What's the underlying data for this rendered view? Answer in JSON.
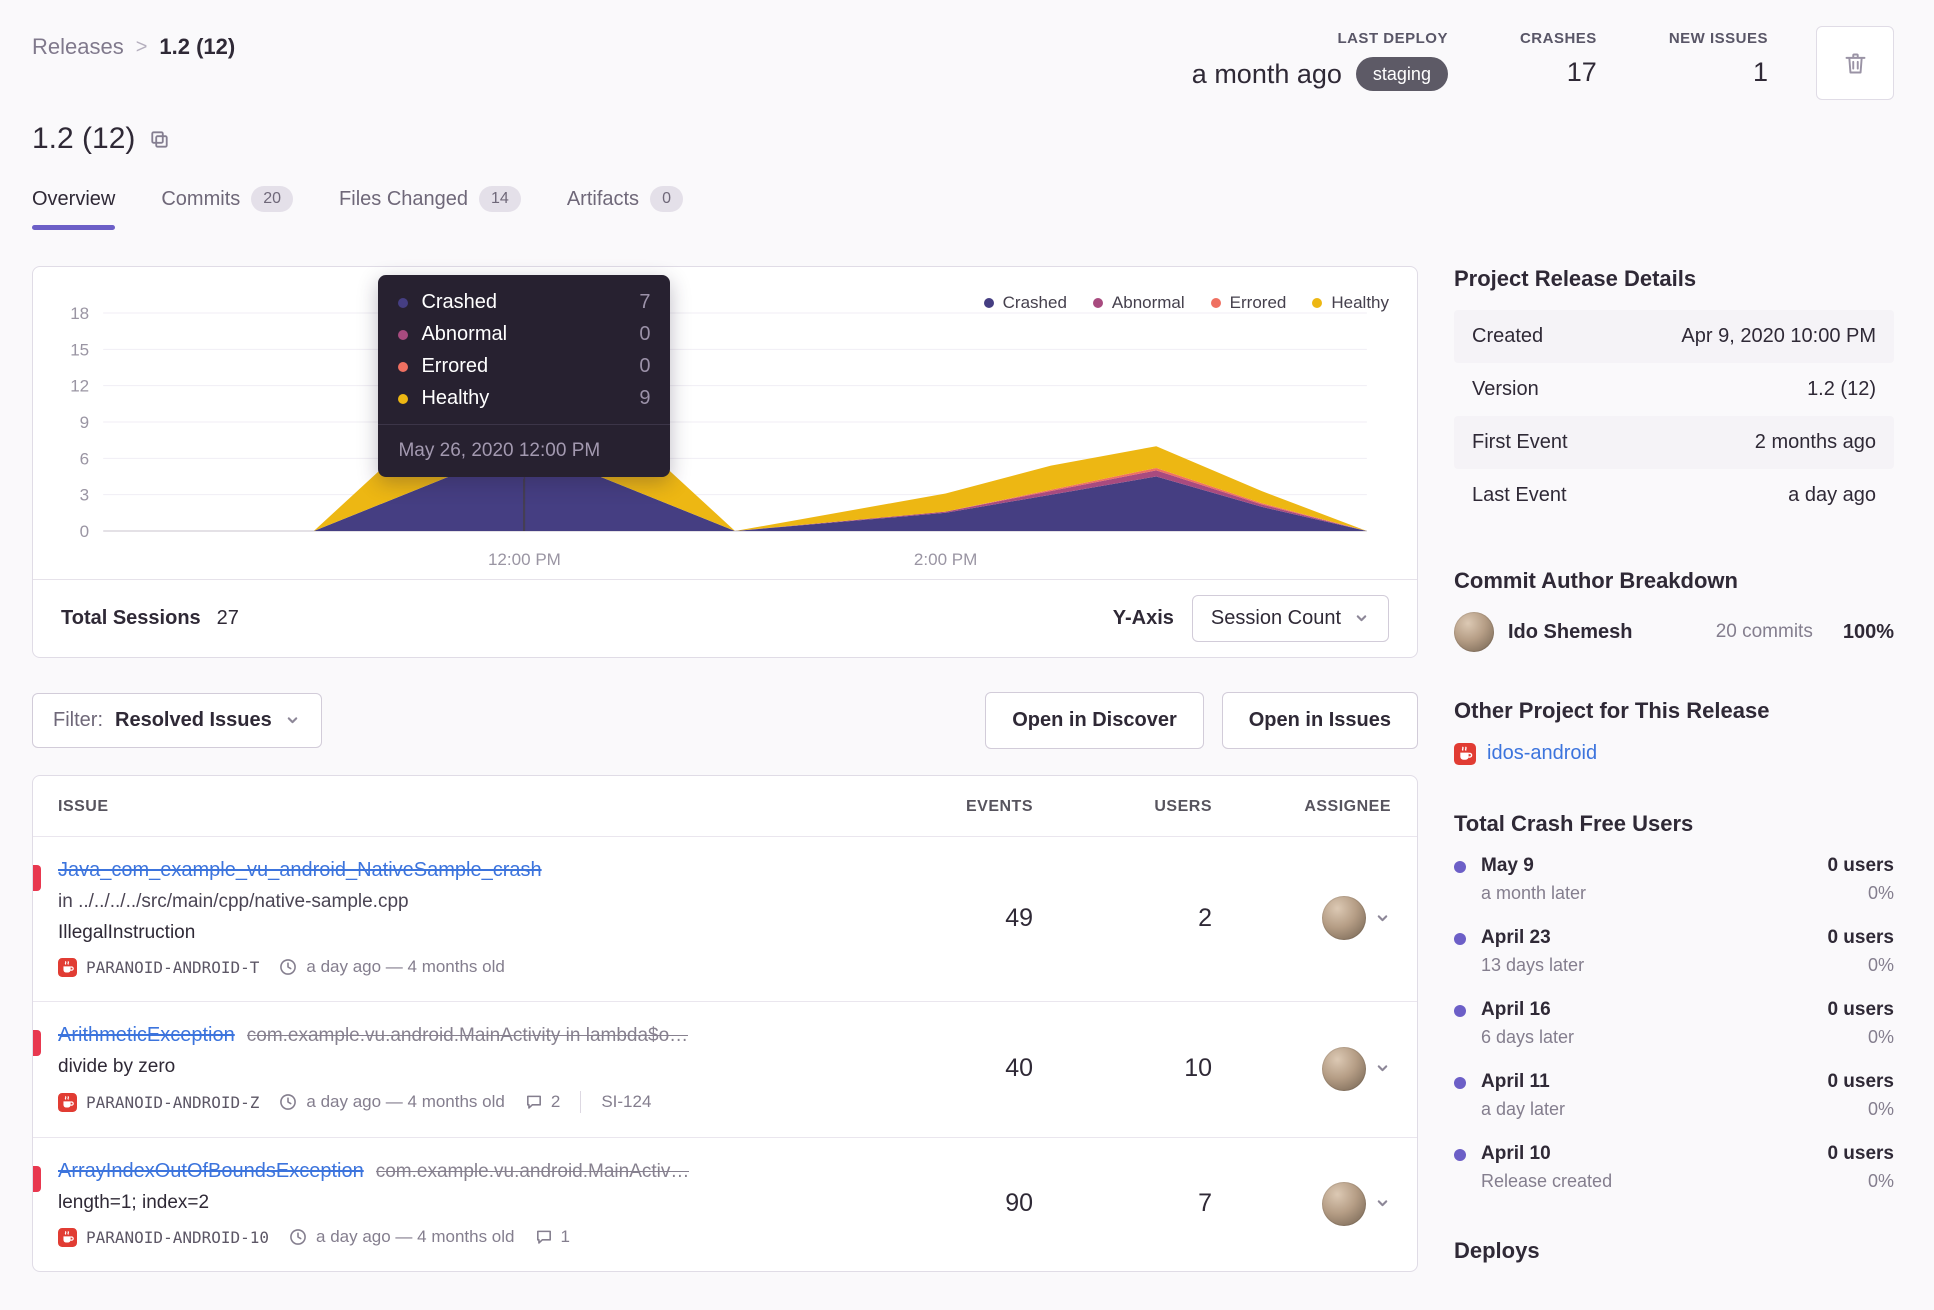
{
  "breadcrumb": {
    "parent": "Releases",
    "separator": ">",
    "current": "1.2 (12)"
  },
  "header_stats": {
    "last_deploy": {
      "label": "LAST DEPLOY",
      "value": "a month ago",
      "badge": "staging"
    },
    "crashes": {
      "label": "CRASHES",
      "value": "17"
    },
    "new_issues": {
      "label": "NEW ISSUES",
      "value": "1"
    }
  },
  "page_title": "1.2 (12)",
  "tabs": [
    {
      "label": "Overview",
      "active": true
    },
    {
      "label": "Commits",
      "count": "20"
    },
    {
      "label": "Files Changed",
      "count": "14"
    },
    {
      "label": "Artifacts",
      "count": "0"
    }
  ],
  "chart": {
    "tooltip": {
      "rows": [
        {
          "label": "Crashed",
          "value": "7"
        },
        {
          "label": "Abnormal",
          "value": "0"
        },
        {
          "label": "Errored",
          "value": "0"
        },
        {
          "label": "Healthy",
          "value": "9"
        }
      ],
      "date": "May 26, 2020 12:00 PM"
    },
    "footer": {
      "total_label": "Total Sessions",
      "total_value": "27",
      "yaxis_label": "Y-Axis",
      "yaxis_value": "Session Count"
    }
  },
  "chart_data": {
    "type": "area",
    "stacked": true,
    "x_range": [
      0,
      6
    ],
    "x": [
      0,
      1,
      2,
      3,
      4,
      4.5,
      5,
      5.5,
      6
    ],
    "series": [
      {
        "name": "Crashed",
        "color": "#453e82",
        "values": [
          0,
          0,
          7,
          0,
          1.5,
          3,
          4.5,
          2,
          0
        ]
      },
      {
        "name": "Abnormal",
        "color": "#a84b7f",
        "values": [
          0,
          0,
          0,
          0,
          0.1,
          0.3,
          0.5,
          0.2,
          0
        ]
      },
      {
        "name": "Errored",
        "color": "#ef7061",
        "values": [
          0,
          0,
          0,
          0,
          0,
          0.1,
          0.2,
          0.1,
          0
        ]
      },
      {
        "name": "Healthy",
        "color": "#edb713",
        "values": [
          0,
          0,
          9,
          0,
          1.5,
          2,
          1.8,
          1,
          0
        ]
      }
    ],
    "ylim": [
      0,
      18
    ],
    "yticks": [
      0,
      3,
      6,
      9,
      12,
      15,
      18
    ],
    "xticks": [
      {
        "pos": 2,
        "label": "12:00 PM"
      },
      {
        "pos": 4,
        "label": "2:00 PM"
      }
    ],
    "tooltip_point": {
      "x": 2,
      "date": "May 26, 2020 12:00 PM",
      "values": {
        "Crashed": 7,
        "Abnormal": 0,
        "Errored": 0,
        "Healthy": 9
      }
    },
    "legend_position": "top-right",
    "grid": true
  },
  "filter_bar": {
    "filter_label": "Filter:",
    "filter_value": "Resolved Issues",
    "discover_button": "Open in Discover",
    "issues_button": "Open in Issues"
  },
  "issues_table": {
    "headers": [
      "ISSUE",
      "EVENTS",
      "USERS",
      "ASSIGNEE"
    ],
    "rows": [
      {
        "title": "Java_com_example_vu_android_NativeSample_crash",
        "culprit": "",
        "subtitle": "in ../../../../src/main/cpp/native-sample.cpp",
        "message": "IllegalInstruction",
        "project": "PARANOID-ANDROID-T",
        "age": "a day ago — 4 months old",
        "comments": "",
        "annotation": "",
        "events": "49",
        "users": "2"
      },
      {
        "title": "ArithmeticException",
        "culprit": "com.example.vu.android.MainActivity in lambda$o…",
        "subtitle": "",
        "message": "divide by zero",
        "project": "PARANOID-ANDROID-Z",
        "age": "a day ago — 4 months old",
        "comments": "2",
        "annotation": "SI-124",
        "events": "40",
        "users": "10"
      },
      {
        "title": "ArrayIndexOutOfBoundsException",
        "culprit": "com.example.vu.android.MainActiv…",
        "subtitle": "",
        "message": "length=1; index=2",
        "project": "PARANOID-ANDROID-10",
        "age": "a day ago — 4 months old",
        "comments": "1",
        "annotation": "",
        "events": "90",
        "users": "7"
      }
    ]
  },
  "sidebar": {
    "release_details": {
      "title": "Project Release Details",
      "rows": [
        [
          "Created",
          "Apr 9, 2020 10:00 PM"
        ],
        [
          "Version",
          "1.2 (12)"
        ],
        [
          "First Event",
          "2 months ago"
        ],
        [
          "Last Event",
          "a day ago"
        ]
      ]
    },
    "commit_authors": {
      "title": "Commit Author Breakdown",
      "author": {
        "name": "Ido Shemesh",
        "commits": "20 commits",
        "percent": "100%"
      }
    },
    "other_projects": {
      "title": "Other Project for This Release",
      "project": "idos-android"
    },
    "crash_free": {
      "title": "Total Crash Free Users",
      "items": [
        {
          "date": "May 9",
          "sub": "a month later",
          "users": "0 users",
          "percent": "0%"
        },
        {
          "date": "April 23",
          "sub": "13 days later",
          "users": "0 users",
          "percent": "0%"
        },
        {
          "date": "April 16",
          "sub": "6 days later",
          "users": "0 users",
          "percent": "0%"
        },
        {
          "date": "April 11",
          "sub": "a day later",
          "users": "0 users",
          "percent": "0%"
        },
        {
          "date": "April 10",
          "sub": "Release created",
          "users": "0 users",
          "percent": "0%"
        }
      ]
    },
    "deploys_title": "Deploys"
  }
}
